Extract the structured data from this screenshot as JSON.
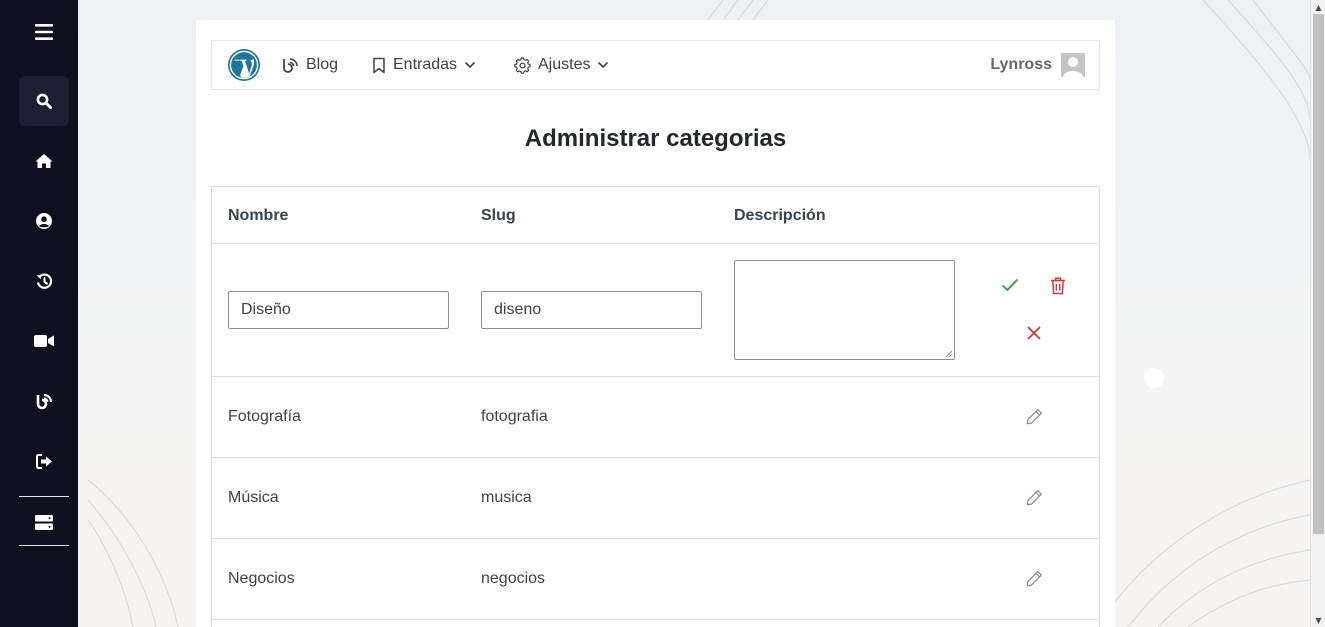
{
  "sidebar": {
    "items": [
      {
        "icon": "menu-icon"
      },
      {
        "icon": "search-icon"
      },
      {
        "icon": "home-icon"
      },
      {
        "icon": "user-circle-icon"
      },
      {
        "icon": "history-icon"
      },
      {
        "icon": "video-camera-icon"
      },
      {
        "icon": "blog-icon"
      },
      {
        "icon": "sign-out-icon"
      },
      {
        "icon": "server-icon"
      }
    ]
  },
  "navbar": {
    "logo": "wordpress-logo",
    "blog_label": "Blog",
    "entradas_label": "Entradas",
    "ajustes_label": "Ajustes",
    "user_name": "Lynross"
  },
  "page": {
    "title": "Administrar categorias"
  },
  "table": {
    "headers": {
      "name": "Nombre",
      "slug": "Slug",
      "description": "Descripción"
    },
    "edit_row": {
      "name": "Diseño",
      "slug": "diseno",
      "description": ""
    },
    "rows": [
      {
        "name": "Fotografía",
        "slug": "fotografia"
      },
      {
        "name": "Música",
        "slug": "musica"
      },
      {
        "name": "Negocios",
        "slug": "negocios"
      }
    ]
  },
  "colors": {
    "sidebar_bg": "#101020",
    "confirm_green": "#4ca14c",
    "danger_red": "#d63638",
    "wp_blue": "#21759b"
  }
}
